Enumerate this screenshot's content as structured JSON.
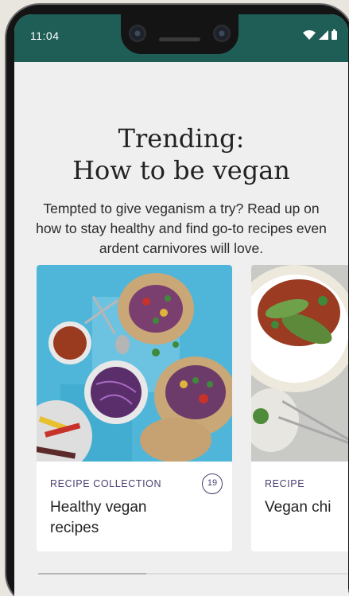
{
  "status_bar": {
    "time": "11:04",
    "icons": [
      "wifi-icon",
      "signal-icon",
      "battery-icon"
    ],
    "color": "#1f5e57"
  },
  "header": {
    "title_line1": "Trending:",
    "title_line2": "How to be vegan",
    "subtitle": "Tempted to give veganism a try? Read up on how to stay healthy and find go-to recipes even ardent carnivores will love."
  },
  "cards": [
    {
      "tag": "RECIPE COLLECTION",
      "title": "Healthy vegan recipes",
      "count": "19"
    },
    {
      "tag": "RECIPE",
      "title": "Vegan chi"
    }
  ],
  "colors": {
    "accent": "#4b3f72",
    "background": "#efefef"
  }
}
